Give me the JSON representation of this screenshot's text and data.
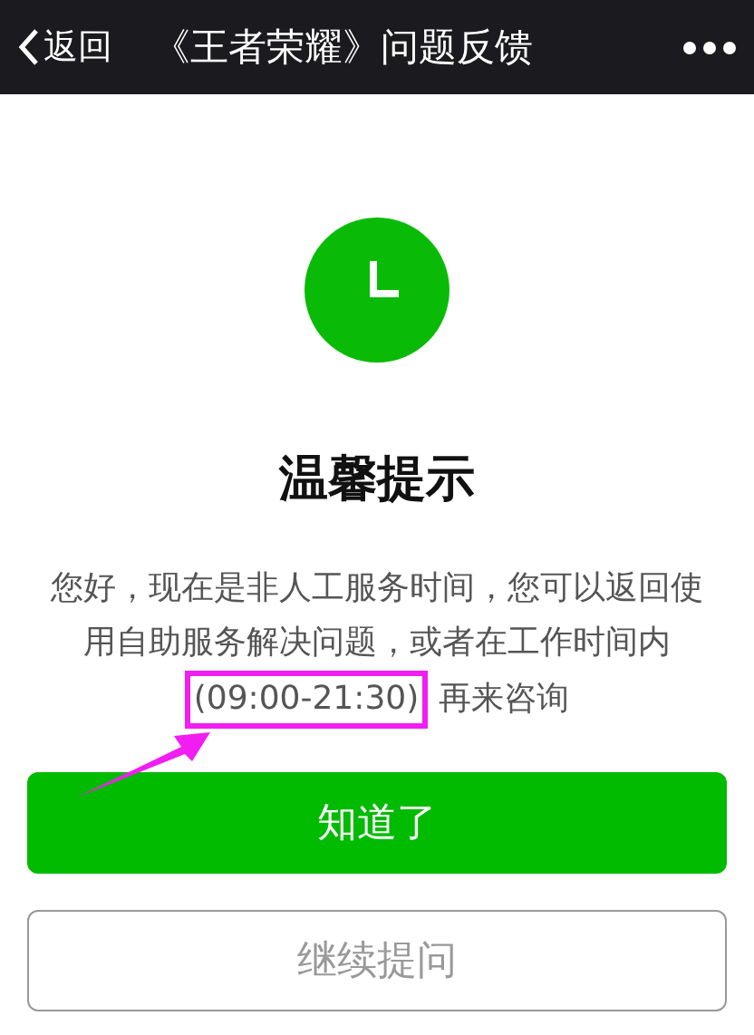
{
  "nav_bar": {
    "back_label": "返回",
    "title": "《王者荣耀》问题反馈"
  },
  "notice": {
    "title": "温馨提示",
    "message": "您好，现在是非人工服务时间，您可以返回使用自助服务解决问题，或者在工作时间内",
    "hours": "(09:00-21:30)",
    "message_end": "再来咨询"
  },
  "buttons": [
    {
      "label": "知道了",
      "kind": "primary"
    },
    {
      "label": "继续提问",
      "kind": "secondary"
    }
  ]
}
